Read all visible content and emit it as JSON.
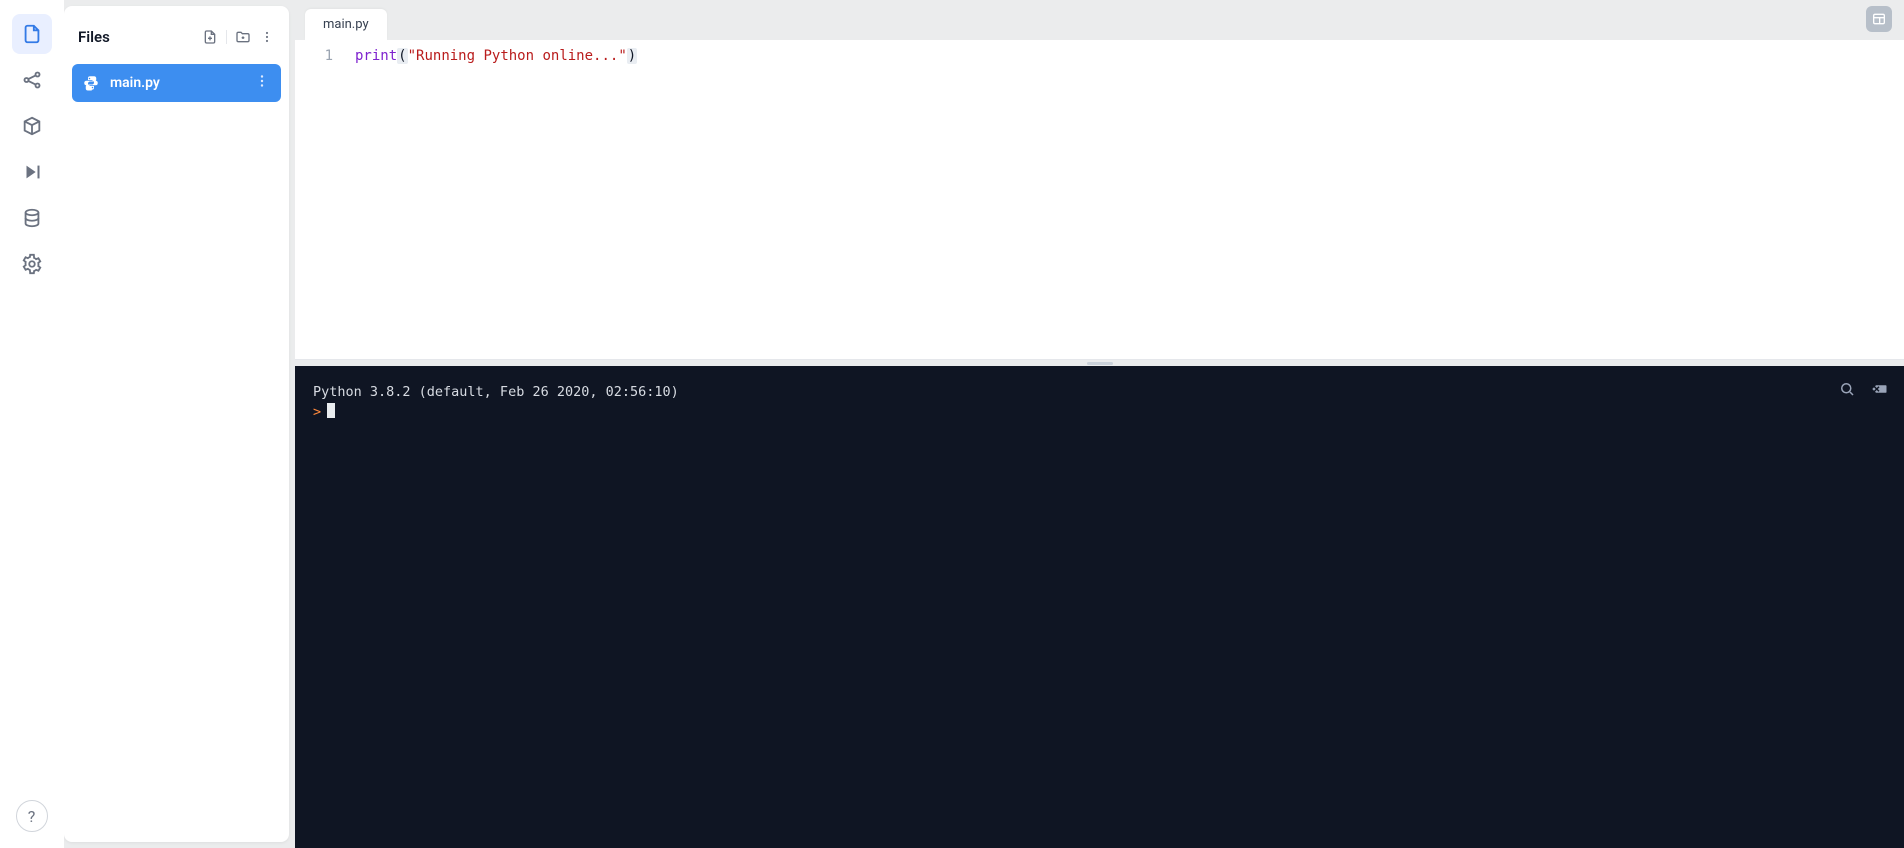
{
  "iconrail": {
    "items": [
      {
        "name": "files-icon",
        "active": true
      },
      {
        "name": "share-icon",
        "active": false
      },
      {
        "name": "packages-icon",
        "active": false
      },
      {
        "name": "run-icon",
        "active": false
      },
      {
        "name": "database-icon",
        "active": false
      },
      {
        "name": "settings-icon",
        "active": false
      }
    ],
    "help_label": "?"
  },
  "filepanel": {
    "title": "Files",
    "files": [
      {
        "name": "main.py",
        "icon": "python-icon",
        "selected": true
      }
    ]
  },
  "editor": {
    "tabs": [
      {
        "label": "main.py",
        "active": true
      }
    ],
    "line_number": "1",
    "code": {
      "fn": "print",
      "open": "(",
      "open_q": "\"",
      "str": "Running Python online...",
      "close_q": "\"",
      "close": ")"
    }
  },
  "console": {
    "banner": "Python 3.8.2 (default, Feb 26 2020, 02:56:10)",
    "prompt": ">"
  }
}
